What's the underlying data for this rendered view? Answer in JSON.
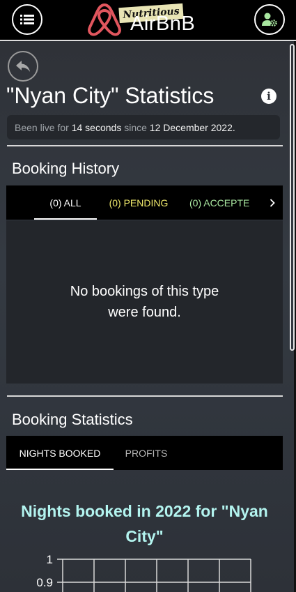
{
  "header": {
    "logo_word": "AirBnB",
    "logo_tag": "Nutritious",
    "icons": {
      "menu": "list-icon",
      "profile": "user-gear-icon",
      "logo": "airbnb-logo-icon"
    }
  },
  "page": {
    "title": "\"Nyan City\" Statistics",
    "live_prefix": "Been live for ",
    "live_duration": "14 seconds",
    "live_middle": " since ",
    "live_date": "12 December 2022."
  },
  "booking_history": {
    "title": "Booking History",
    "tabs": [
      {
        "label": "(0) ALL",
        "color": "#ffffff",
        "active": true
      },
      {
        "label": "(0) PENDING",
        "color": "#f1ea6c",
        "active": false
      },
      {
        "label": "(0) ACCEPTE",
        "color": "#a9e7a0",
        "active": false
      }
    ],
    "empty_message": "No bookings of this type were found."
  },
  "booking_statistics": {
    "title": "Booking Statistics",
    "tabs": [
      {
        "label": "NIGHTS BOOKED",
        "active": true
      },
      {
        "label": "PROFITS",
        "active": false
      }
    ]
  },
  "chart_data": {
    "type": "bar",
    "title": "Nights booked in 2022 for \"Nyan City\"",
    "y_tick_labels": [
      "1",
      "0.9"
    ],
    "ylim": [
      0,
      1
    ],
    "grid": true,
    "title_color": "#b3f4ef"
  }
}
